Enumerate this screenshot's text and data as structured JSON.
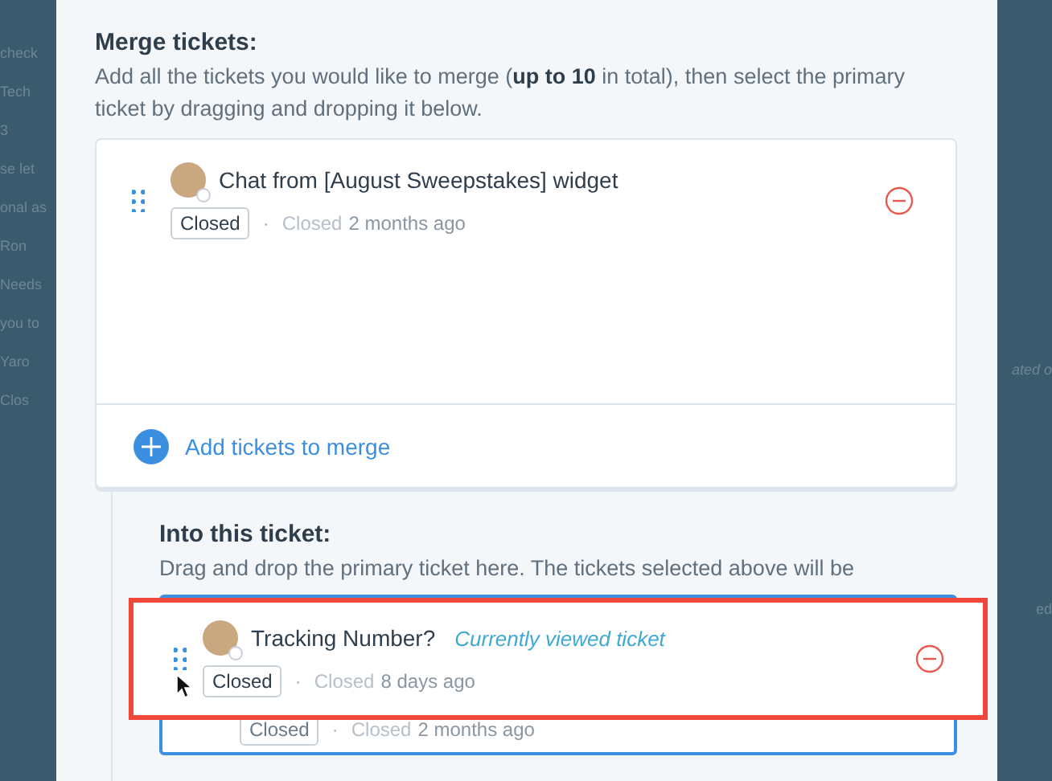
{
  "background": {
    "left_fragments": [
      "check",
      "Tech",
      "3",
      "se let",
      "onal as",
      "Ron",
      "Needs",
      "you to",
      "Yaro",
      "Clos"
    ],
    "right_fragments": [
      "ated o",
      "ed"
    ]
  },
  "merge": {
    "title": "Merge tickets:",
    "description": "Add all the tickets you would like to merge (**up to 10** in total), then select the primary ticket by dragging and dropping it below.",
    "tickets": [
      {
        "subject": "Chat from [August Sweepstakes] widget",
        "status": "Closed",
        "separator": "·",
        "closed_label": "Closed",
        "time": "2 months ago"
      }
    ],
    "add_button": "Add tickets to merge"
  },
  "into": {
    "title": "Into this ticket:",
    "description": "Drag and drop the primary ticket here. The tickets selected above will be",
    "target": {
      "status": "Closed",
      "separator": "·",
      "closed_label": "Closed",
      "time": "2 months ago"
    }
  },
  "dragged": {
    "subject": "Tracking Number?",
    "note": "Currently viewed ticket",
    "status": "Closed",
    "separator": "·",
    "closed_label": "Closed",
    "time": "8 days ago",
    "highlighted": true
  }
}
